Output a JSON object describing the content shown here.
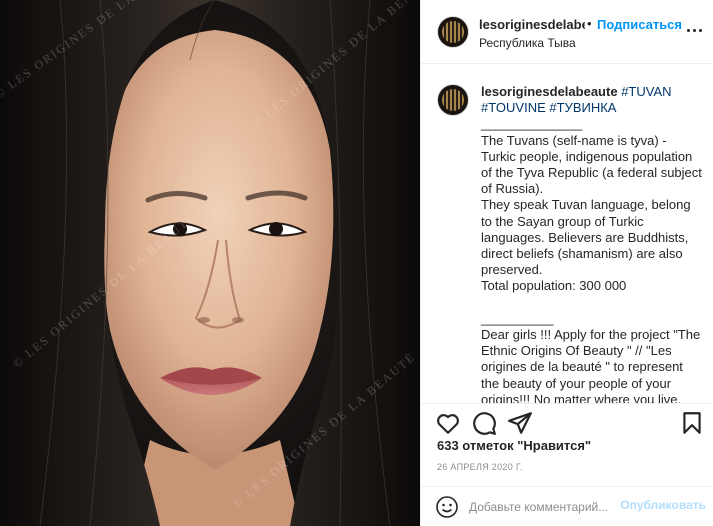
{
  "post": {
    "header": {
      "username": "lesoriginesdelabeaute",
      "separator": "•",
      "follow_label": "Подписаться",
      "location": "Республика Тыва"
    },
    "watermark": "© Les Origines de la Beauté",
    "caption": {
      "username": "lesoriginesdelabeaute",
      "hashtags": "#TUVAN #TOUVINE #ТУВИНКА",
      "body": "\n______________\nThe Tuvans (self-name is tyva) - Turkic people, indigenous population of the Tyva Republic (a federal subject of Russia).\nThey speak Tuvan language, belong to the Sayan group of Turkic languages. Believers are Buddhists, direct beliefs (shamanism) are also preserved.\nTotal population: 300 000\n\n__________\nDear girls !!! Apply for the project \"The Ethnic Origins Of Beauty \" // \"Les origines de la beauté \" to represent the beauty of your people of your origins!!! No matter where you live. Follow the instructions on our website www.lesoriginesdelabeaute.com //"
    },
    "likes_text": "633 отметок \"Нравится\"",
    "date": "26 АПРЕЛЯ 2020 Г.",
    "comment_placeholder": "Добавьте комментарий...",
    "publish_label": "Опубликовать",
    "icons": {
      "like": "heart-icon",
      "comment": "comment-icon",
      "share": "share-icon",
      "save": "bookmark-icon",
      "more": "more-options-icon",
      "emoji": "emoji-icon"
    },
    "colors": {
      "follow": "#0095f6",
      "publish_disabled": "#b2dffc",
      "hashtag": "#00376b",
      "border": "#efefef"
    }
  }
}
